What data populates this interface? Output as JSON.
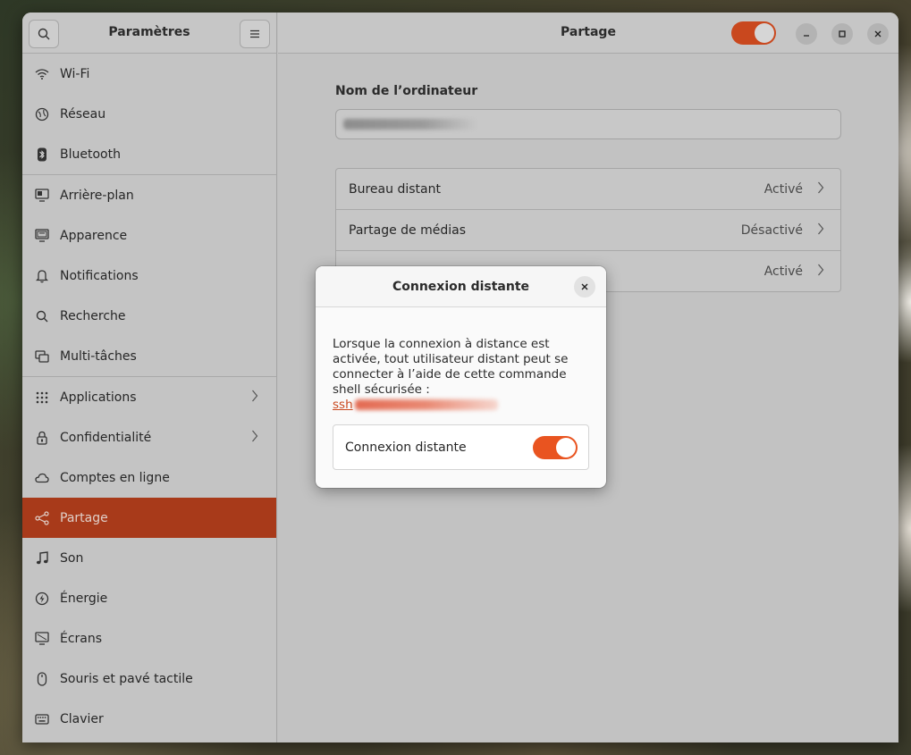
{
  "sidebar": {
    "title": "Paramètres",
    "search_icon": "search-icon",
    "menu_icon": "hamburger-menu-icon",
    "items": [
      {
        "label": "Wi-Fi",
        "icon": "wifi-icon"
      },
      {
        "label": "Réseau",
        "icon": "globe-icon"
      },
      {
        "label": "Bluetooth",
        "icon": "bluetooth-icon"
      },
      {
        "label": "Arrière-plan",
        "icon": "display-background-icon"
      },
      {
        "label": "Apparence",
        "icon": "appearance-icon"
      },
      {
        "label": "Notifications",
        "icon": "bell-icon"
      },
      {
        "label": "Recherche",
        "icon": "search-icon"
      },
      {
        "label": "Multi-tâches",
        "icon": "multitasking-icon"
      },
      {
        "label": "Applications",
        "icon": "apps-grid-icon"
      },
      {
        "label": "Confidentialité",
        "icon": "lock-icon"
      },
      {
        "label": "Comptes en ligne",
        "icon": "cloud-icon"
      },
      {
        "label": "Partage",
        "icon": "share-icon"
      },
      {
        "label": "Son",
        "icon": "music-note-icon"
      },
      {
        "label": "Énergie",
        "icon": "power-icon"
      },
      {
        "label": "Écrans",
        "icon": "monitor-icon"
      },
      {
        "label": "Souris et pavé tactile",
        "icon": "mouse-icon"
      },
      {
        "label": "Clavier",
        "icon": "keyboard-icon"
      }
    ]
  },
  "main": {
    "title": "Partage",
    "computer_name_label": "Nom de l’ordinateur",
    "rows": [
      {
        "label": "Bureau distant",
        "status": "Activé"
      },
      {
        "label": "Partage de médias",
        "status": "Désactivé"
      },
      {
        "label": "",
        "status": "Activé"
      }
    ]
  },
  "dialog": {
    "title": "Connexion distante",
    "description": "Lorsque la connexion à distance est activée, tout utilisateur distant peut se connecter à l’aide de cette commande shell sécurisée :",
    "ssh_prefix": "ssh",
    "toggle_label": "Connexion distante"
  },
  "colors": {
    "accent": "#e95420",
    "active_sidebar": "#a83a1a"
  }
}
